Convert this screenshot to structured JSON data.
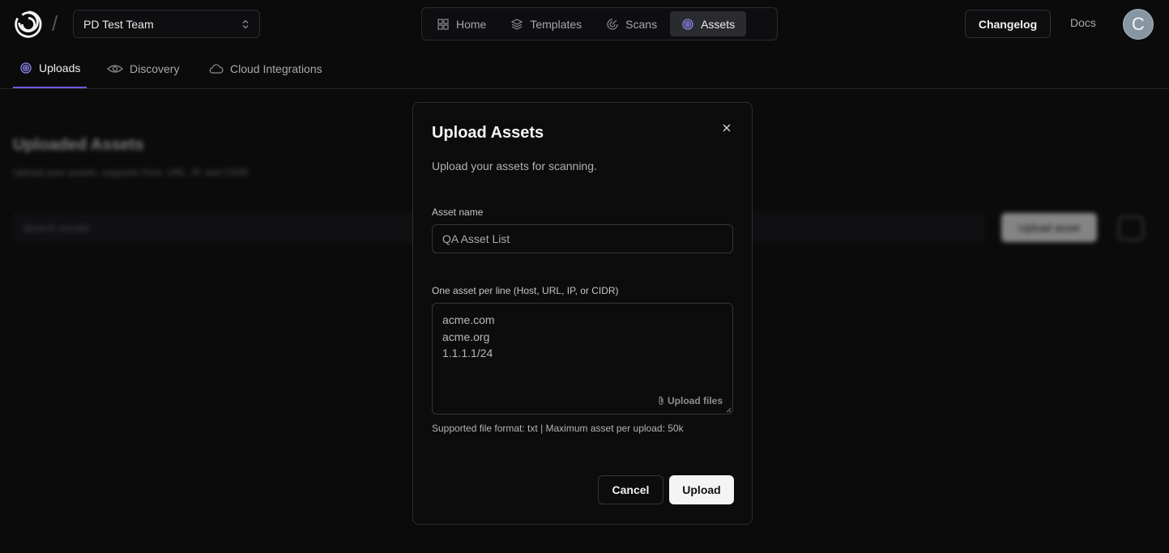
{
  "header": {
    "team_select": "PD Test Team",
    "nav": [
      {
        "label": "Home",
        "icon": "grid-icon",
        "active": false
      },
      {
        "label": "Templates",
        "icon": "layers-icon",
        "active": false
      },
      {
        "label": "Scans",
        "icon": "radar-icon",
        "active": false
      },
      {
        "label": "Assets",
        "icon": "target-icon",
        "active": true
      }
    ],
    "changelog_label": "Changelog",
    "docs_label": "Docs",
    "avatar_initial": "C"
  },
  "subtabs": [
    {
      "label": "Uploads",
      "icon": "target-icon",
      "active": true
    },
    {
      "label": "Discovery",
      "icon": "eye-icon",
      "active": false
    },
    {
      "label": "Cloud Integrations",
      "icon": "cloud-icon",
      "active": false
    }
  ],
  "background_page": {
    "title": "Uploaded Assets",
    "subtitle": "Upload your assets, supports Host, URL, IP, and CIDR.",
    "search_placeholder": "Search results",
    "upload_button": "Upload asset"
  },
  "modal": {
    "title": "Upload Assets",
    "description": "Upload your assets for scanning.",
    "asset_name_label": "Asset name",
    "asset_name_value": "QA Asset List",
    "assets_label": "One asset per line (Host, URL, IP, or CIDR)",
    "assets_lines": [
      "acme.com",
      "acme.org",
      "1.1.1.1/24"
    ],
    "upload_files_label": "Upload files",
    "hint": "Supported file format: txt | Maximum asset per upload: 50k",
    "cancel_label": "Cancel",
    "upload_label": "Upload"
  },
  "colors": {
    "background": "#0b0b0c",
    "accent": "#6e5bdc"
  }
}
